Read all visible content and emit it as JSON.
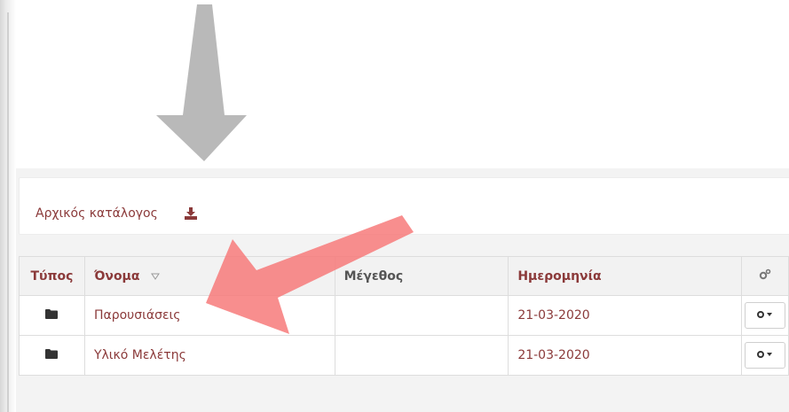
{
  "breadcrumb": {
    "root_label": "Αρχικός κατάλογος"
  },
  "table": {
    "headers": {
      "type": "Τύπος",
      "name": "Όνομα",
      "size": "Μέγεθος",
      "date": "Ημερομηνία"
    },
    "rows": [
      {
        "type_icon": "folder-icon",
        "name": "Παρουσιάσεις",
        "size": "",
        "date": "21-03-2020"
      },
      {
        "type_icon": "folder-icon",
        "name": "Υλικό Μελέτης",
        "size": "",
        "date": "21-03-2020"
      }
    ]
  },
  "colors": {
    "link": "#8b3a3a",
    "header_bg": "#f2f2f2",
    "arrow_gray": "#b5b5b5",
    "arrow_red": "#f77a7a"
  }
}
